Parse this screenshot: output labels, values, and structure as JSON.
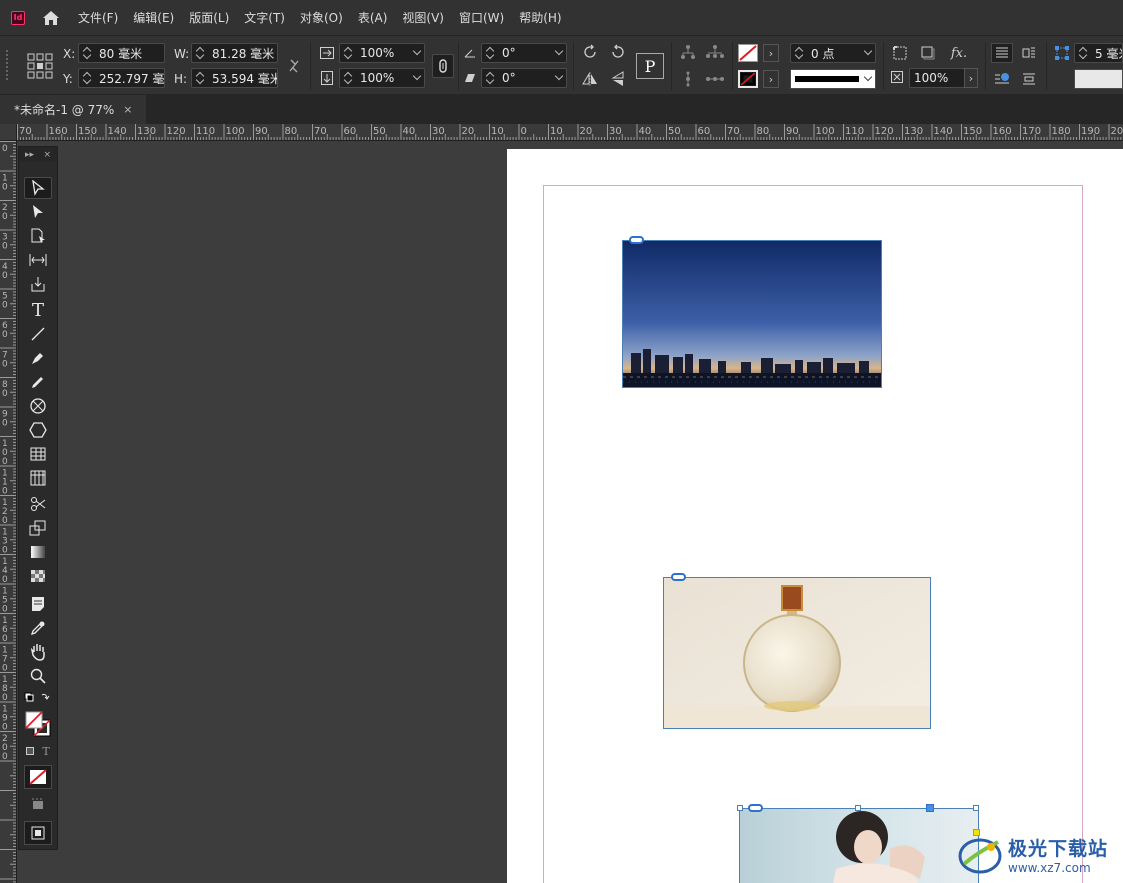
{
  "app": {
    "icon_text": "Id"
  },
  "menu": [
    "文件(F)",
    "编辑(E)",
    "版面(L)",
    "文字(T)",
    "对象(O)",
    "表(A)",
    "视图(V)",
    "窗口(W)",
    "帮助(H)"
  ],
  "control": {
    "x_label": "X:",
    "x_value": "80 毫米",
    "y_label": "Y:",
    "y_value": "252.797 毫",
    "w_label": "W:",
    "w_value": "81.28 毫米",
    "h_label": "H:",
    "h_value": "53.594 毫米",
    "scale_x": "100%",
    "scale_y": "100%",
    "rotate": "0°",
    "shear": "0°",
    "stroke_weight": "0 点",
    "opacity": "100%",
    "gap": "5 毫米",
    "paragraph_glyph": "P",
    "fx_label": "fx."
  },
  "document": {
    "tab_title": "*未命名-1 @ 77%",
    "close_glyph": "×"
  },
  "ruler_h": [
    "70",
    "160",
    "150",
    "140",
    "130",
    "120",
    "110",
    "100",
    "90",
    "80",
    "70",
    "60",
    "50",
    "40",
    "30",
    "20",
    "10",
    "0",
    "10",
    "20",
    "30",
    "40",
    "50",
    "60",
    "70",
    "80",
    "90",
    "100",
    "110",
    "120",
    "130",
    "140",
    "150",
    "160",
    "170",
    "180",
    "190",
    "200"
  ],
  "ruler_v": [
    "0",
    "1 0",
    "2 0",
    "3 0",
    "4 0",
    "5 0",
    "6 0",
    "7 0",
    "8 0",
    "9 0",
    "1 0 0",
    "1 1 0",
    "1 2 0",
    "1 3 0",
    "1 4 0",
    "1 5 0",
    "1 6 0",
    "1 7 0",
    "1 8 0",
    "1 9 0",
    "2 0 0"
  ],
  "tools_panel": {
    "collapse_glyph": "▸▸",
    "close_glyph": "×",
    "text_glyph": "T",
    "small_text_glyph": "T"
  },
  "watermark": {
    "title": "极光下载站",
    "url": "www.xz7.com"
  },
  "colors": {
    "accent": "#2f6fce",
    "brand": "#ff3366",
    "frame_border": "#4a7fb8",
    "margin_guide": "#d6a6c2"
  }
}
